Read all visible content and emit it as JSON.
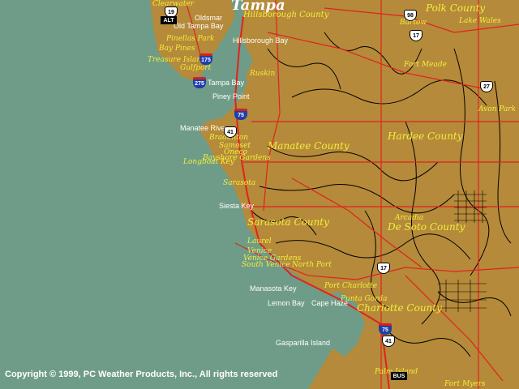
{
  "map": {
    "colors": {
      "water": "#6f9c88",
      "land": "#b58a3a",
      "roads": "#e0231d",
      "streams": "#000000",
      "labels": "#f2ee3a"
    },
    "counties": [
      "Hillsborough County",
      "Polk County",
      "Manatee County",
      "Hardee County",
      "Sarasota County",
      "De Soto County",
      "Charlotte County"
    ],
    "cities": [
      "Tampa",
      "Clearwater",
      "Oldsmar",
      "Pinellas Park",
      "Bay Pines",
      "Treasure Island",
      "Gulfport",
      "Ruskin",
      "Piney Point",
      "Bartow",
      "Lake Wales",
      "Fort Meade",
      "Avon Park",
      "Bradenton",
      "Samoset",
      "Oneco",
      "Bayshore Gardens",
      "Longboat Key",
      "Sarasota",
      "Siesta Key",
      "Laurel",
      "Venice",
      "Venice Gardens",
      "South Venice",
      "North Port",
      "Manasota Key",
      "Arcadia",
      "Port Charlotte",
      "Punta Gorda",
      "Lemon Bay",
      "Gasparilla Island",
      "Palm Island",
      "Fort Myers"
    ],
    "water_labels": [
      "Hillsborough Bay",
      "Tampa Bay",
      "Manatee River",
      "Cape Haze",
      "Old Tampa Bay"
    ],
    "highways": {
      "interstate": [
        "175",
        "275",
        "75",
        "75"
      ],
      "us": [
        "19",
        "98",
        "17",
        "27",
        "41",
        "17",
        "41"
      ],
      "special": [
        "ALT",
        "BUS"
      ]
    },
    "copyright": "Copyright © 1999, PC Weather Products, Inc., All rights reserved"
  }
}
